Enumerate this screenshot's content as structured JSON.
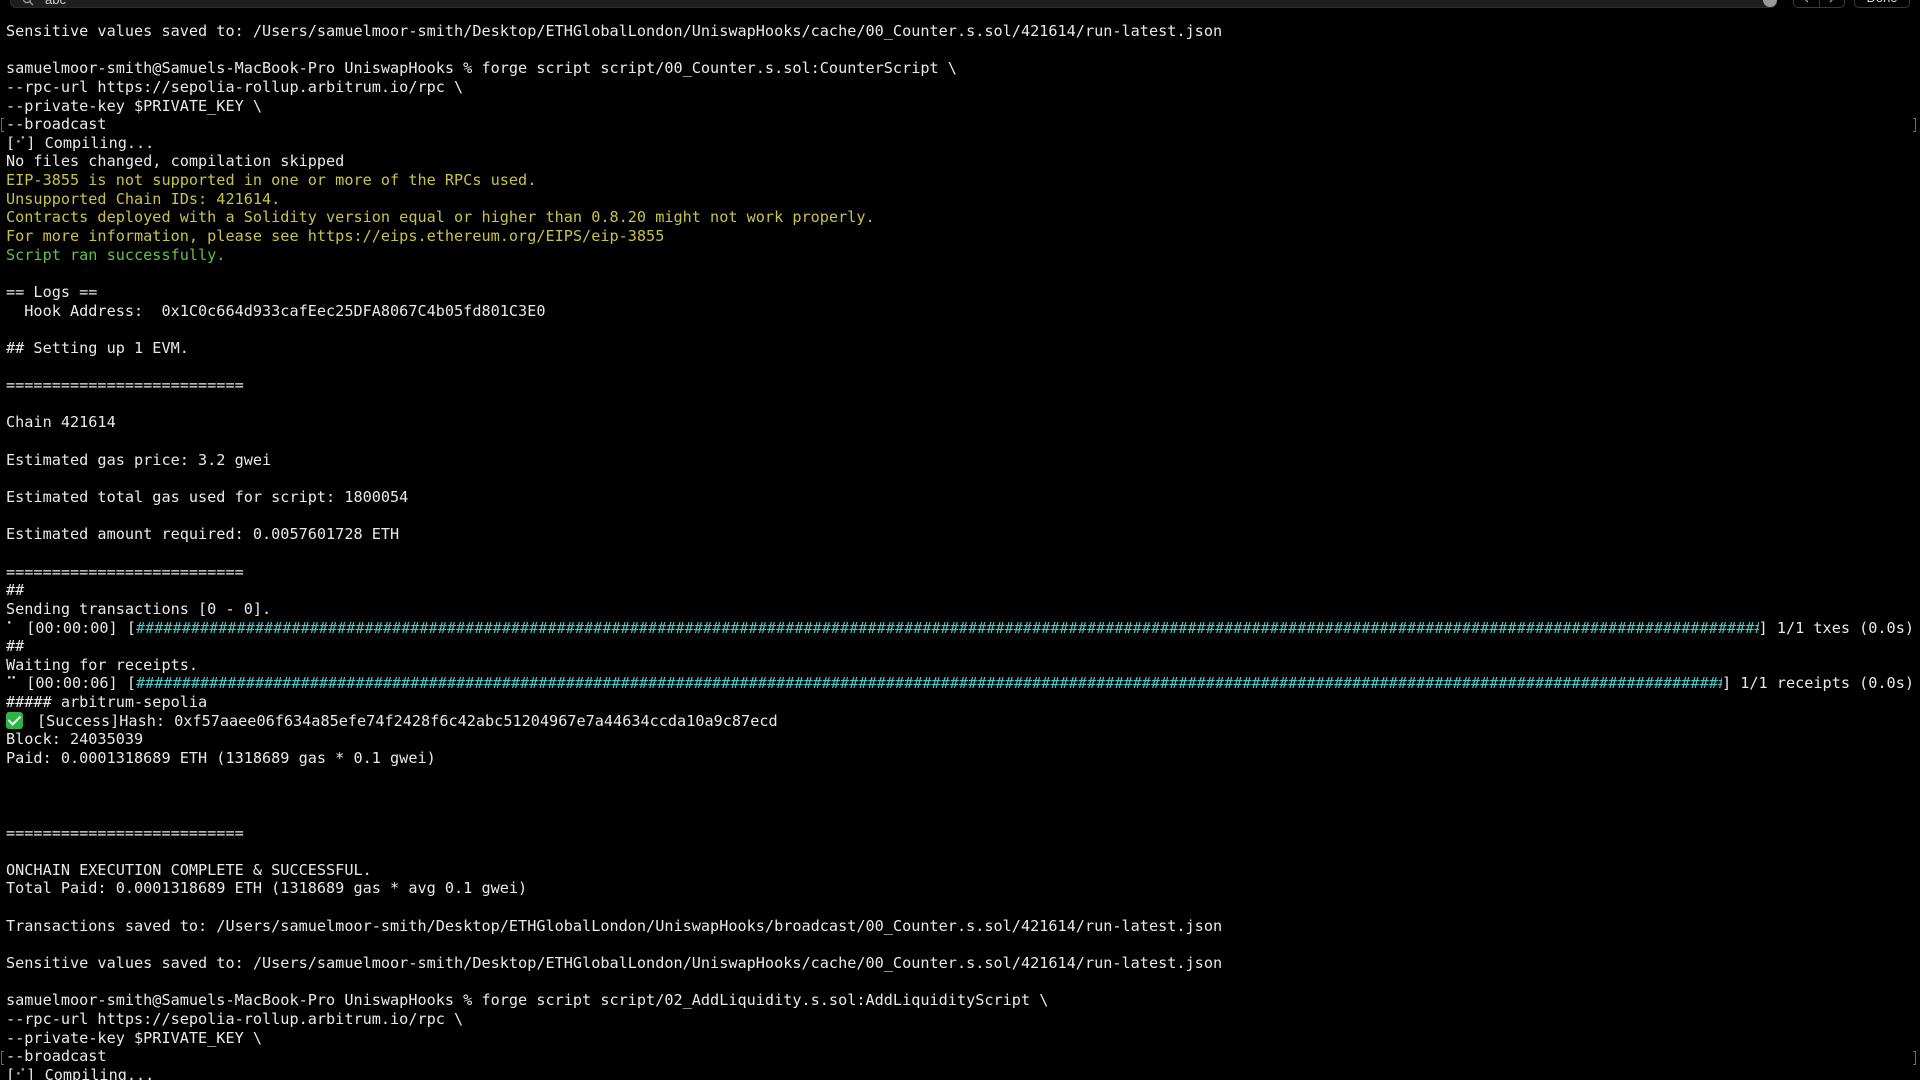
{
  "findbar": {
    "query": "abc",
    "done_label": "Done"
  },
  "colors": {
    "background": "#000000",
    "text": "#e9e9e9",
    "warning": "#c9c24a",
    "success": "#5fc24a",
    "progress": "#4cc8c8"
  },
  "lines": {
    "l01": "Sensitive values saved to: /Users/samuelmoor-smith/Desktop/ETHGlobalLondon/UniswapHooks/cache/00_Counter.s.sol/421614/run-latest.json",
    "l02": "",
    "l03": "samuelmoor-smith@Samuels-MacBook-Pro UniswapHooks % forge script script/00_Counter.s.sol:CounterScript \\",
    "l04": "--rpc-url https://sepolia-rollup.arbitrum.io/rpc \\",
    "l05": "--private-key $PRIVATE_KEY \\",
    "l06": "--broadcast",
    "l07_prefix": "[",
    "l07_spinner": "⠊",
    "l07_suffix": "] Compiling...",
    "l08": "No files changed, compilation skipped",
    "l09": "EIP-3855 is not supported in one or more of the RPCs used.",
    "l10": "Unsupported Chain IDs: 421614.",
    "l11": "Contracts deployed with a Solidity version equal or higher than 0.8.20 might not work properly.",
    "l12": "For more information, please see https://eips.ethereum.org/EIPS/eip-3855",
    "l13": "Script ran successfully.",
    "l14": "",
    "l15": "== Logs ==",
    "l16": "  Hook Address:  0x1C0c664d933cafEec25DFA8067C4b05fd801C3E0",
    "l17": "",
    "l18": "## Setting up 1 EVM.",
    "l19": "",
    "l20": "==========================",
    "l21": "",
    "l22": "Chain 421614",
    "l23": "",
    "l24": "Estimated gas price: 3.2 gwei",
    "l25": "",
    "l26": "Estimated total gas used for script: 1800054",
    "l27": "",
    "l28": "Estimated amount required: 0.0057601728 ETH",
    "l29": "",
    "l30": "==========================",
    "l31": "##",
    "l32": "Sending transactions [0 - 0].",
    "l33_prefix": "⠁ [00:00:00] [",
    "l33_bar": "#####################################################################################################################################################################################",
    "l33_suffix": "] 1/1 txes (0.0s)",
    "l34": "##",
    "l35": "Waiting for receipts.",
    "l36_prefix": "⠉ [00:00:06] [",
    "l36_bar": "#####################################################################################################################################################################################",
    "l36_suffix": "] 1/1 receipts (0.0s)",
    "l37": "##### arbitrum-sepolia",
    "l38": "[Success]Hash: 0xf57aaee06f634a85efe74f2428f6c42abc51204967e7a44634ccda10a9c87ecd",
    "l39": "Block: 24035039",
    "l40": "Paid: 0.0001318689 ETH (1318689 gas * 0.1 gwei)",
    "l41": "",
    "l42": "",
    "l43": "",
    "l44": "==========================",
    "l45": "",
    "l46": "ONCHAIN EXECUTION COMPLETE & SUCCESSFUL.",
    "l47": "Total Paid: 0.0001318689 ETH (1318689 gas * avg 0.1 gwei)",
    "l48": "",
    "l49": "Transactions saved to: /Users/samuelmoor-smith/Desktop/ETHGlobalLondon/UniswapHooks/broadcast/00_Counter.s.sol/421614/run-latest.json",
    "l50": "",
    "l51": "Sensitive values saved to: /Users/samuelmoor-smith/Desktop/ETHGlobalLondon/UniswapHooks/cache/00_Counter.s.sol/421614/run-latest.json",
    "l52": "",
    "l53": "samuelmoor-smith@Samuels-MacBook-Pro UniswapHooks % forge script script/02_AddLiquidity.s.sol:AddLiquidityScript \\",
    "l54": "--rpc-url https://sepolia-rollup.arbitrum.io/rpc \\",
    "l55": "--private-key $PRIVATE_KEY \\",
    "l56": "--broadcast",
    "l57_prefix": "[",
    "l57_spinner": "⠊",
    "l57_suffix": "] Compiling..."
  }
}
